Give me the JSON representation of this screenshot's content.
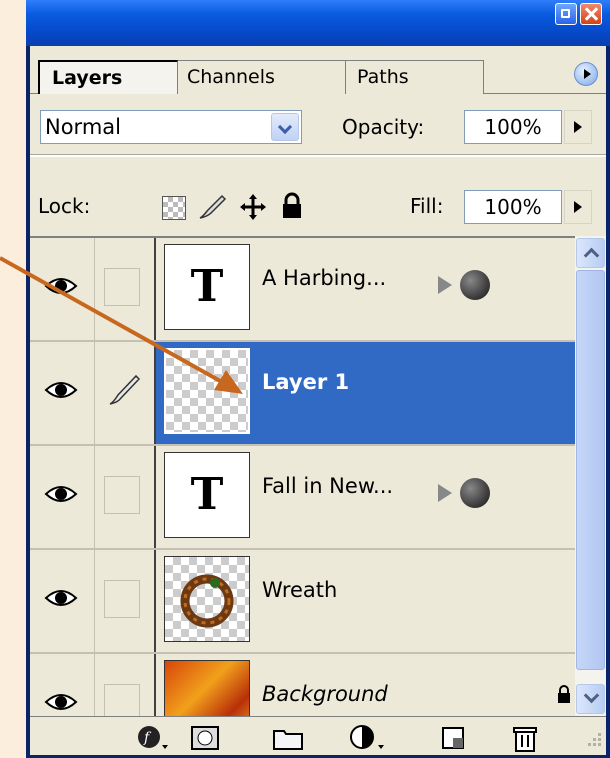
{
  "window": {
    "controls": {
      "minimize_icon": "minimize-icon",
      "close_icon": "close-icon"
    }
  },
  "tabs": [
    {
      "label": "Layers",
      "active": true
    },
    {
      "label": "Channels",
      "active": false
    },
    {
      "label": "Paths",
      "active": false
    }
  ],
  "blend_mode": {
    "value": "Normal"
  },
  "opacity": {
    "label": "Opacity:",
    "value": "100%"
  },
  "lock": {
    "label": "Lock:"
  },
  "fill": {
    "label": "Fill:",
    "value": "100%"
  },
  "layers": [
    {
      "name": "A Harbing...",
      "type": "text",
      "visible": true,
      "has_effects": true,
      "selected": false
    },
    {
      "name": "Layer 1",
      "type": "raster",
      "visible": true,
      "has_effects": false,
      "selected": true
    },
    {
      "name": "Fall in New...",
      "type": "text",
      "visible": true,
      "has_effects": true,
      "selected": false
    },
    {
      "name": "Wreath",
      "type": "image",
      "visible": true,
      "has_effects": false,
      "selected": false
    },
    {
      "name": "Background",
      "type": "background",
      "visible": true,
      "has_effects": false,
      "selected": false
    }
  ],
  "bottom_toolbar": {
    "icons": [
      "layer-style-icon",
      "layer-mask-icon",
      "new-group-icon",
      "adjustment-layer-icon",
      "new-layer-icon",
      "trash-icon"
    ]
  },
  "colors": {
    "selection": "#316ac5",
    "panel": "#ece9d8",
    "title_bar": "#0a5ce0",
    "annotation_arrow": "#c8671e",
    "page_background": "#fbeedd"
  }
}
